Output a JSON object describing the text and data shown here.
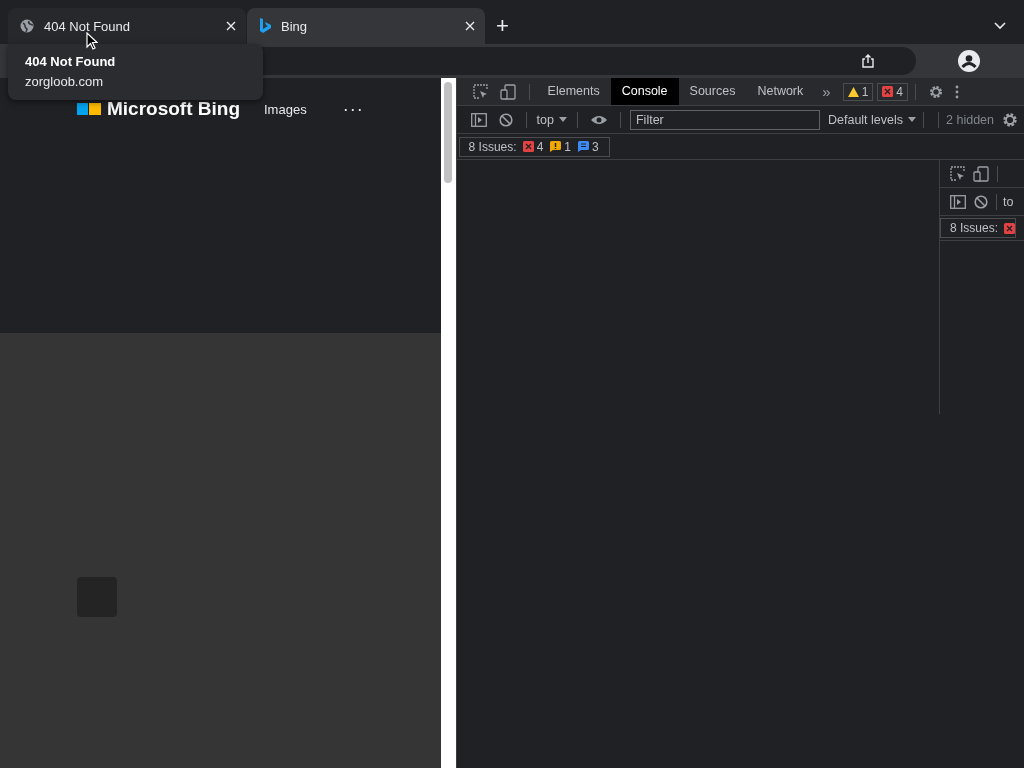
{
  "browser": {
    "tabs": [
      {
        "title": "404 Not Found",
        "kind": "globe",
        "selected": false
      },
      {
        "title": "Bing",
        "kind": "bing",
        "selected": true
      }
    ],
    "new_tab": "+",
    "tooltip": {
      "title": "404 Not Found",
      "url": "zorgloob.com"
    }
  },
  "page": {
    "logo": "Microsoft Bing",
    "nav": "Images",
    "more": "···"
  },
  "devtools": {
    "panel_tabs": [
      {
        "label": "Elements",
        "selected": false
      },
      {
        "label": "Console",
        "selected": true
      },
      {
        "label": "Sources",
        "selected": false
      },
      {
        "label": "Network",
        "selected": false
      }
    ],
    "more_tabs": "»",
    "counters": [
      {
        "kind": "warning",
        "count": "1"
      },
      {
        "kind": "error",
        "count": "4"
      }
    ],
    "console_toolbar": {
      "context": "top",
      "filter_placeholder": "Filter",
      "levels": "Default levels",
      "hidden": "2 hidden"
    },
    "issues": {
      "label": "8 Issues:",
      "counts": [
        {
          "kind": "error",
          "count": "4"
        },
        {
          "kind": "warning",
          "count": "1"
        },
        {
          "kind": "info",
          "count": "3"
        }
      ]
    },
    "nested": {
      "context": "to",
      "issues_label": "8 Issues:"
    }
  }
}
